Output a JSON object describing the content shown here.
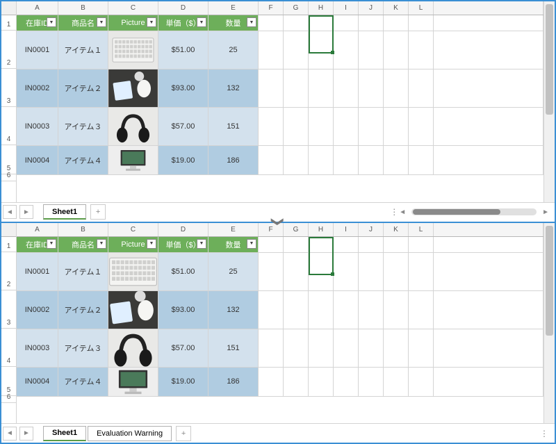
{
  "columns": [
    "A",
    "B",
    "C",
    "D",
    "E",
    "F",
    "G",
    "H",
    "I",
    "J",
    "K",
    "L"
  ],
  "headers": {
    "A": "在庫ID",
    "B": "商品名",
    "C": "Picture",
    "D": "単価（$）",
    "E": "数量"
  },
  "rows": [
    {
      "id": "IN0001",
      "name": "アイテム１",
      "pic": "keyboard",
      "price": "$51.00",
      "qty": "25"
    },
    {
      "id": "IN0002",
      "name": "アイテム２",
      "pic": "mouse-note",
      "price": "$93.00",
      "qty": "132"
    },
    {
      "id": "IN0003",
      "name": "アイテム３",
      "pic": "headphones",
      "price": "$57.00",
      "qty": "151"
    },
    {
      "id": "IN0004",
      "name": "アイテム４",
      "pic": "monitor",
      "price": "$19.00",
      "qty": "186"
    }
  ],
  "tabs_top": [
    "Sheet1"
  ],
  "tabs_bottom": [
    "Sheet1",
    "Evaluation Warning"
  ],
  "selected_cell": "H",
  "row_header_h": 22,
  "data_row_h": 55
}
